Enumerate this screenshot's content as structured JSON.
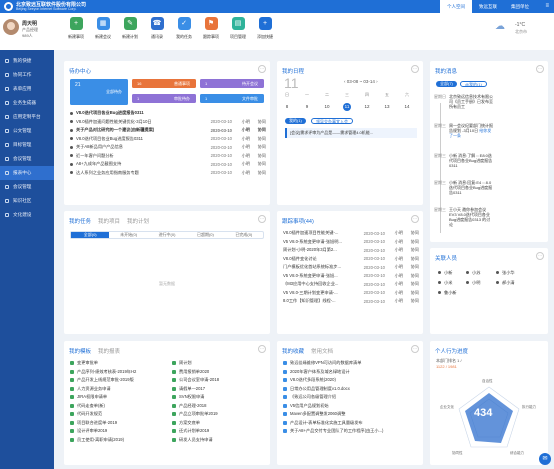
{
  "header": {
    "company": "北京致远互联软件股份有限公司",
    "company_en": "Beijing Seeyon Internet Software Corp.",
    "tabs": [
      "个人空间",
      "致远互联",
      "集团单位"
    ],
    "menu_icon": "menu-icon"
  },
  "user": {
    "name": "周天明",
    "role": "产品经理",
    "points": "989人"
  },
  "nav": [
    "我的快捷",
    "协同工作",
    "表单应用",
    "业务生成器",
    "应用定制平台",
    "公文管理",
    "目标管理",
    "会议管理",
    "报表中心",
    "会议管理",
    "知识社区",
    "文化建设"
  ],
  "quick": [
    {
      "label": "新建事项",
      "color": "#3da55d",
      "icon": "+"
    },
    {
      "label": "新建会议",
      "color": "#3a8ee6",
      "icon": "▦"
    },
    {
      "label": "新建计划",
      "color": "#3da55d",
      "icon": "✎"
    },
    {
      "label": "通讯录",
      "color": "#2f6fce",
      "icon": "☎"
    },
    {
      "label": "我的任务",
      "color": "#3a8ee6",
      "icon": "✓"
    },
    {
      "label": "跟踪事项",
      "color": "#e8743b",
      "icon": "⚑"
    },
    {
      "label": "项目管理",
      "color": "#2fb39a",
      "icon": "▤"
    },
    {
      "label": "添加快捷",
      "color": "#1f6fd6",
      "icon": "+"
    }
  ],
  "weather": {
    "temp": "-1°C",
    "city": "北京市"
  },
  "todo": {
    "title": "待办中心",
    "tiles": [
      {
        "count": "21",
        "label": "全部待办",
        "color": "#3a8ee6"
      },
      {
        "count": "16",
        "label": "普通事项",
        "color": "#e8743b"
      },
      {
        "count": "1",
        "label": "待开会议",
        "color": "#8e72d6"
      },
      {
        "count": "1",
        "label": "审批待办",
        "color": "#8e72d6"
      },
      {
        "count": "1",
        "label": "文件审批",
        "color": "#3a8ee6"
      }
    ],
    "rows": [
      {
        "title": "V8.0迭代项目各业Bug进度报告0311",
        "date": "",
        "author": "",
        "status": ""
      },
      {
        "title": "V8.0插件加速问题性能关键优化-3月10日",
        "date": "2020-03-10",
        "author": "小明",
        "status": "协同"
      },
      {
        "title": "关于产品对比研究的一个建议(由新疆提案)",
        "date": "2020-03-10",
        "author": "小明",
        "status": "协同"
      },
      {
        "title": "V8.0迭代项目各业Bug进度报告0311",
        "date": "2020-03-10",
        "author": "小明",
        "status": "协同"
      },
      {
        "title": "关于A8新品用户产品信息",
        "date": "2020-03-10",
        "author": "小明",
        "status": "协同"
      },
      {
        "title": "近一年客户问题分析",
        "date": "2020-03-10",
        "author": "小明",
        "status": "协同"
      },
      {
        "title": "A8+九成年产品截图支持",
        "date": "2020-03-10",
        "author": "小明",
        "status": "协同"
      },
      {
        "title": "达人系列之业务应用指南服务专题",
        "date": "2020-03-10",
        "author": "小明",
        "status": "协同"
      }
    ]
  },
  "schedule": {
    "title": "我的日程",
    "big": "11",
    "range": "03-08 ~ 03-14",
    "weekdays": [
      "日",
      "一",
      "二",
      "三",
      "四",
      "五",
      "六"
    ],
    "days": [
      "8",
      "9",
      "10",
      "11",
      "12",
      "13",
      "14"
    ],
    "buttons": [
      "我的(1)",
      "领导交办事宜入会"
    ],
    "item": "[会议]需求评审为产品是——需求管理4.0机能..."
  },
  "news": {
    "title": "我的消息",
    "pills": [
      "全部(7)",
      "@我的(1)"
    ],
    "items": [
      {
        "time": "星期日",
        "text": "北京致远信息技术有限公司《员工手册》已发布至所有员工"
      },
      {
        "time": "星期三",
        "text": "周一会议纪要部门统计报告规划 -3月10日",
        "hi": "给你发了一条"
      },
      {
        "time": "星期三",
        "text": "小新 消息:了解 :: E8:0迭代项目各业Bug进度报告0311"
      },
      {
        "time": "星期三",
        "text": "小新 消息:回复:E4 :: 8.0迭代项目各业Bug进度报告0311"
      },
      {
        "time": "星期三",
        "text": "王小天 邀你参加会议 EV3 V8.0迭代项目各业Bug进度报告0313 的讨论"
      }
    ]
  },
  "tasks": {
    "tabs_title": [
      "我的任务",
      "我的项目",
      "我的计划"
    ],
    "subtabs": [
      "全部(0)",
      "未开始(0)",
      "进行中(0)",
      "已超期(0)",
      "已完成(0)"
    ],
    "empty": "暂无数据"
  },
  "tracking": {
    "title": "跟踪事项(44)",
    "rows": [
      {
        "title": "V8.0插件加速项目性能关键-...",
        "date": "2020-03-10",
        "author": "小明",
        "status": "协同"
      },
      {
        "title": "V5 V8.0-系统变更申请-张旭明...",
        "date": "2020-03-10",
        "author": "小明",
        "status": "协同"
      },
      {
        "title": "周计划-小明-2020年3月第2...",
        "date": "2020-03-10",
        "author": "小明",
        "status": "协同"
      },
      {
        "title": "V8.0插件变化讨论",
        "date": "2020-03-10",
        "author": "小明",
        "status": "协同"
      },
      {
        "title": "门户模板优化首站系统标准步...",
        "date": "2020-03-10",
        "author": "小明",
        "status": "协同"
      },
      {
        "title": "V5 V8.0-系统变更申请-张旭...",
        "date": "2020-03-10",
        "author": "小明",
        "status": "协同"
      },
      {
        "title": "《M3应用中心支持回收企业...",
        "date": "2020-03-10",
        "author": "小明",
        "status": "协同"
      },
      {
        "title": "V5 V8.0-三期计划变更申请-...",
        "date": "2020-03-10",
        "author": "小明",
        "status": "协同"
      },
      {
        "title": "8.0工作【知识管理】线程-...",
        "date": "2020-03-10",
        "author": "小明",
        "status": "协同"
      }
    ]
  },
  "people": {
    "title": "关联人员",
    "list": [
      "小新",
      "小苏",
      "张小华",
      "小米",
      "小明",
      "郝小清",
      "鲁小新"
    ]
  },
  "templates": {
    "tabs_title": [
      "我的模板",
      "我的报表"
    ],
    "col1": [
      "变更审批单",
      "产品序列-绩效考核表-2019年H2",
      "产品开发上线规范审批-2019版",
      "人力资源业务申请",
      "JIRA权限申请单",
      "代码走查单(新)",
      "代码开发规范",
      "项目联合进度单-2019",
      "设计评审单2019",
      "员工使用-离职申请(2019)"
    ],
    "col2": [
      "周计划",
      "费用报销单2020",
      "公司会议室申请-2018",
      "请假单—2017",
      "SVN权限申请",
      "产品经理-2018",
      "产品立项审批单2019",
      "方案交底单",
      "还式计划单2019",
      "研发人员支持申请"
    ]
  },
  "docs": {
    "tabs_title": [
      "我的收藏",
      "常用文档"
    ],
    "rows": [
      "致远佳缘维修VPN可访问的数据库清单",
      "2020年客户体系及域名绿地设计",
      "V8.0迭代多段系统(2020)",
      "日常办公用品管理制度v1.0.docx",
      "《致远公司各级管理介绍",
      "V5信用产品规划初始",
      "Maven多配置调整发2060调整",
      "产品设计-表单标准化实施工具量级发布",
      "关于A8+产品交付专业团队了的工作程序(由王小...)"
    ]
  },
  "behavior": {
    "title": "个人行为进度",
    "score": "434",
    "rank_text": "本部门排名 1 /",
    "rank": "1122 / 1981",
    "axes": [
      "自治性",
      "执行能力",
      "综合能力",
      "协同性",
      "企业文化"
    ]
  }
}
